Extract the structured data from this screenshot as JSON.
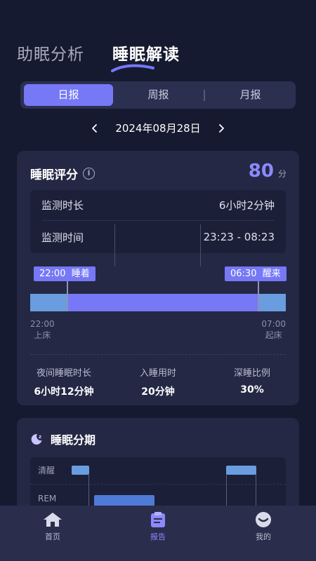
{
  "header": {
    "tabs": [
      {
        "label": "助眠分析",
        "active": false
      },
      {
        "label": "睡眠解读",
        "active": true
      }
    ]
  },
  "period": {
    "tabs": [
      {
        "label": "日报",
        "active": true
      },
      {
        "label": "周报",
        "active": false
      },
      {
        "label": "月报",
        "active": false
      }
    ]
  },
  "date": {
    "current": "2024年08月28日",
    "prev_icon": "chevron-left-icon",
    "next_icon": "chevron-right-icon"
  },
  "score_card": {
    "title": "睡眠评分",
    "score": "80",
    "score_unit": "分",
    "stats": [
      {
        "label": "监测时长",
        "value": "6小时2分钟"
      },
      {
        "label": "监测时间",
        "value": "23:23 - 08:23"
      }
    ],
    "timeline": {
      "sleep_tag_time": "22:00",
      "sleep_tag_label": "睡着",
      "wake_tag_time": "06:30",
      "wake_tag_label": "醒来",
      "bed_time": "22:00",
      "bed_label": "上床",
      "rise_time": "07:00",
      "rise_label": "起床"
    },
    "summary": [
      {
        "label": "夜间睡眠时长",
        "value": "6小时12分钟"
      },
      {
        "label": "入睡用时",
        "value": "20分钟"
      },
      {
        "label": "深睡比例",
        "value": "30%"
      }
    ]
  },
  "stage_card": {
    "title": "睡眠分期",
    "icon": "moon-sleep-icon",
    "stages": [
      "清醒",
      "REM"
    ]
  },
  "bottom_nav": [
    {
      "label": "首页",
      "icon": "home-icon",
      "active": false
    },
    {
      "label": "报告",
      "icon": "report-clipboard-icon",
      "active": true
    },
    {
      "label": "我的",
      "icon": "profile-icon",
      "active": false
    }
  ],
  "colors": {
    "background": "#161a30",
    "card": "#242844",
    "accent": "#7678f6",
    "score": "#8c89ff",
    "light_sleep": "#6a9de0"
  }
}
